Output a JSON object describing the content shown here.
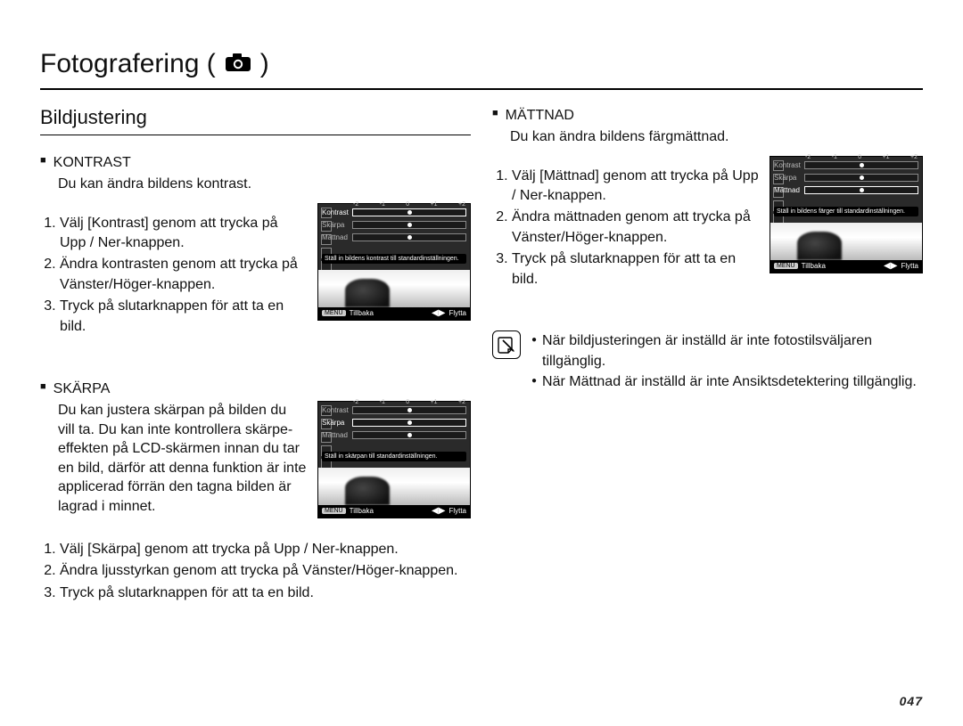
{
  "page": {
    "title": "Fotografering (",
    "title_close": ")"
  },
  "left": {
    "subheading": "Bildjustering",
    "kontrast": {
      "title": "KONTRAST",
      "intro": "Du kan ändra bildens kontrast.",
      "steps": [
        "Välj [Kontrast] genom att trycka på Upp / Ner-knappen.",
        "Ändra kontrasten genom att trycka på Vänster/Höger-knappen.",
        "Tryck på slutarknappen för att ta en bild."
      ]
    },
    "skarpa": {
      "title": "SKÄRPA",
      "intro": "Du kan justera skärpan på bilden du vill ta. Du kan inte kontrollera skärpe-effekten på LCD-skärmen innan du tar en bild, därför att denna funktion är inte applicerad förrän den tagna bilden är lagrad i minnet.",
      "steps": [
        "Välj [Skärpa] genom att trycka på Upp / Ner-knappen.",
        "Ändra ljusstyrkan genom att trycka på Vänster/Höger-knappen.",
        "Tryck på slutarknappen för att ta en bild."
      ]
    }
  },
  "right": {
    "mattnad": {
      "title": "MÄTTNAD",
      "intro": "Du kan ändra bildens färgmättnad.",
      "steps": [
        "Välj [Mättnad] genom att trycka på Upp / Ner-knappen.",
        "Ändra mättnaden genom att trycka på Vänster/Höger-knappen.",
        "Tryck på slutarknappen för att ta en bild."
      ]
    },
    "notes": [
      "När bildjusteringen är inställd är inte fotostilsväljaren tillgänglig.",
      "När Mättnad är inställd är inte Ansiktsdetektering tillgänglig."
    ]
  },
  "thumb_common": {
    "ticks": [
      "-2",
      "-1",
      "0",
      "+1",
      "+2"
    ],
    "back": "Tillbaka",
    "move": "Flytta",
    "menu": "MENU"
  },
  "thumbs": {
    "kontrast": {
      "rows": [
        {
          "label": "Kontrast",
          "selected": true
        },
        {
          "label": "Skärpa",
          "selected": false
        },
        {
          "label": "Mättnad",
          "selected": false
        }
      ],
      "msg": "Ställ in bildens kontrast till standardinställningen."
    },
    "skarpa": {
      "rows": [
        {
          "label": "Kontrast",
          "selected": false
        },
        {
          "label": "Skärpa",
          "selected": true
        },
        {
          "label": "Mättnad",
          "selected": false
        }
      ],
      "msg": "Ställ in skärpan till standardinställningen."
    },
    "mattnad": {
      "rows": [
        {
          "label": "Kontrast",
          "selected": false
        },
        {
          "label": "Skärpa",
          "selected": false
        },
        {
          "label": "Mättnad",
          "selected": true
        }
      ],
      "msg": "Ställ in bildens färger till standardinställningen."
    }
  },
  "pagenum": "047"
}
